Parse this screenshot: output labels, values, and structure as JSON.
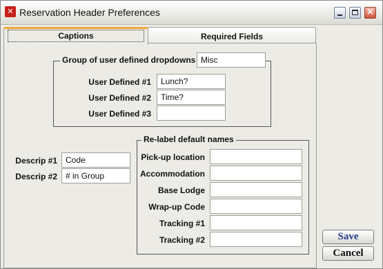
{
  "window": {
    "title": "Reservation Header Preferences",
    "app_icon": "app-logo-icon"
  },
  "tabs": [
    {
      "label": "Captions",
      "active": true
    },
    {
      "label": "Required Fields",
      "active": false
    }
  ],
  "dropdown_group": {
    "title": "Group of user defined dropdowns",
    "group_value": "Misc",
    "fields": [
      {
        "label": "User Defined #1",
        "value": "Lunch?"
      },
      {
        "label": "User Defined #2",
        "value": "Time?"
      },
      {
        "label": "User Defined #3",
        "value": ""
      }
    ]
  },
  "descrip": [
    {
      "label": "Descrip #1",
      "value": "Code"
    },
    {
      "label": "Descrip #2",
      "value": "# in Group"
    }
  ],
  "relabel_group": {
    "title": "Re-label default names",
    "fields": [
      {
        "label": "Pick-up location",
        "value": ""
      },
      {
        "label": "Accommodation",
        "value": ""
      },
      {
        "label": "Base Lodge",
        "value": ""
      },
      {
        "label": "Wrap-up Code",
        "value": ""
      },
      {
        "label": "Tracking #1",
        "value": ""
      },
      {
        "label": "Tracking #2",
        "value": ""
      }
    ]
  },
  "buttons": {
    "save": "Save",
    "cancel": "Cancel",
    "save_color": "#1f3c8c",
    "cancel_color": "#111111"
  }
}
